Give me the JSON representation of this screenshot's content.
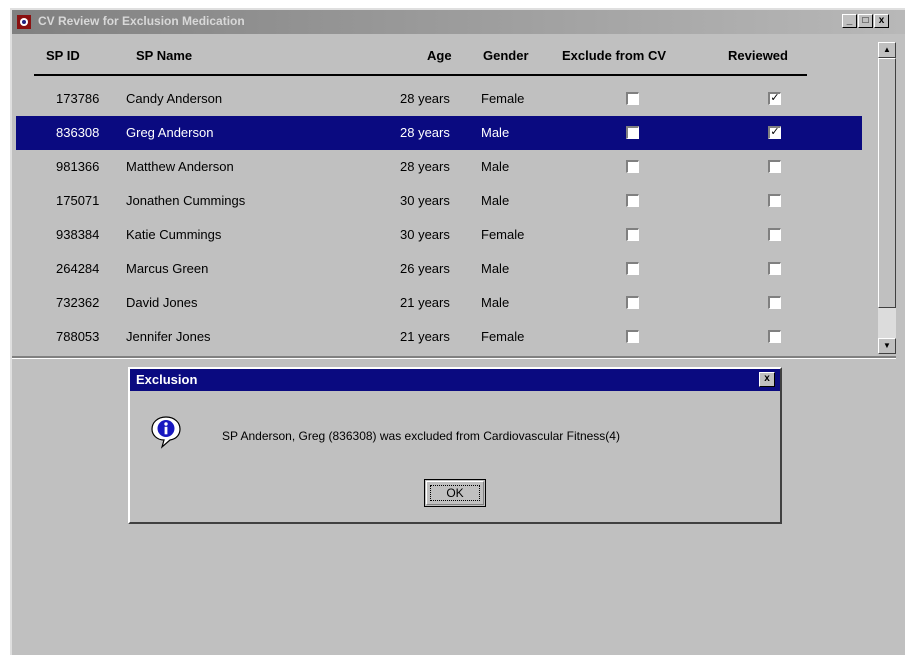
{
  "window": {
    "title": "CV Review for Exclusion Medication",
    "buttons": {
      "minimize": "_",
      "maximize": "□",
      "close": "x"
    }
  },
  "columns": {
    "sp_id": "SP ID",
    "sp_name": "SP Name",
    "age": "Age",
    "gender": "Gender",
    "exclude": "Exclude from CV",
    "reviewed": "Reviewed"
  },
  "rows": [
    {
      "id": "173786",
      "name": "Candy Anderson",
      "age": "28 years",
      "gender": "Female",
      "exclude": "",
      "reviewed": "✓",
      "selected": false
    },
    {
      "id": "836308",
      "name": "Greg Anderson",
      "age": "28 years",
      "gender": "Male",
      "exclude": "",
      "reviewed": "✓",
      "selected": true
    },
    {
      "id": "981366",
      "name": "Matthew Anderson",
      "age": "28 years",
      "gender": "Male",
      "exclude": "",
      "reviewed": "",
      "selected": false
    },
    {
      "id": "175071",
      "name": "Jonathen Cummings",
      "age": "30 years",
      "gender": "Male",
      "exclude": "",
      "reviewed": "",
      "selected": false
    },
    {
      "id": "938384",
      "name": "Katie Cummings",
      "age": "30 years",
      "gender": "Female",
      "exclude": "",
      "reviewed": "",
      "selected": false
    },
    {
      "id": "264284",
      "name": "Marcus Green",
      "age": "26 years",
      "gender": "Male",
      "exclude": "",
      "reviewed": "",
      "selected": false
    },
    {
      "id": "732362",
      "name": "David Jones",
      "age": "21 years",
      "gender": "Male",
      "exclude": "",
      "reviewed": "",
      "selected": false
    },
    {
      "id": "788053",
      "name": "Jennifer Jones",
      "age": "21 years",
      "gender": "Female",
      "exclude": "",
      "reviewed": "",
      "selected": false
    }
  ],
  "scrollbar": {
    "up": "▲",
    "down": "▼"
  },
  "dialog": {
    "title": "Exclusion",
    "close": "x",
    "message": "SP Anderson, Greg (836308) was excluded from Cardiovascular Fitness(4)",
    "ok": "OK",
    "icon": "info-icon"
  },
  "colors": {
    "selection": "#0a0a80",
    "dialog_title": "#0a0a80",
    "window_bg": "#c0c0c0"
  }
}
